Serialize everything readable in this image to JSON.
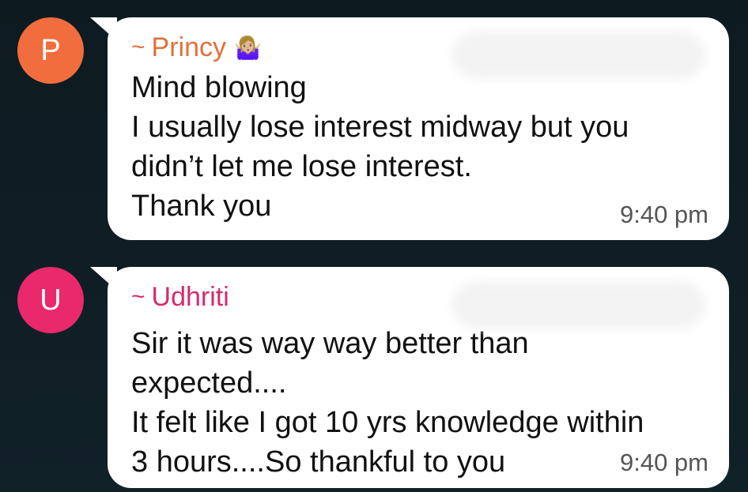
{
  "messages": [
    {
      "avatar_letter": "P",
      "avatar_color": "#f26d3d",
      "sender_prefix": "~",
      "sender": "Princy",
      "sender_color": "#e2703a",
      "sender_emoji": "🤷🏼‍♀️",
      "lines": [
        "Mind blowing",
        "I usually lose interest midway but you",
        "didn’t let me lose interest.",
        "Thank you"
      ],
      "time": "9:40 pm"
    },
    {
      "avatar_letter": "U",
      "avatar_color": "#e9296c",
      "sender_prefix": "~",
      "sender": "Udhriti",
      "sender_color": "#d62a6f",
      "lines": [
        "Sir it was way way better than",
        "expected....",
        "It felt like I got 10 yrs knowledge within",
        "3 hours....So thankful to you"
      ],
      "time": "9:40 pm"
    }
  ]
}
